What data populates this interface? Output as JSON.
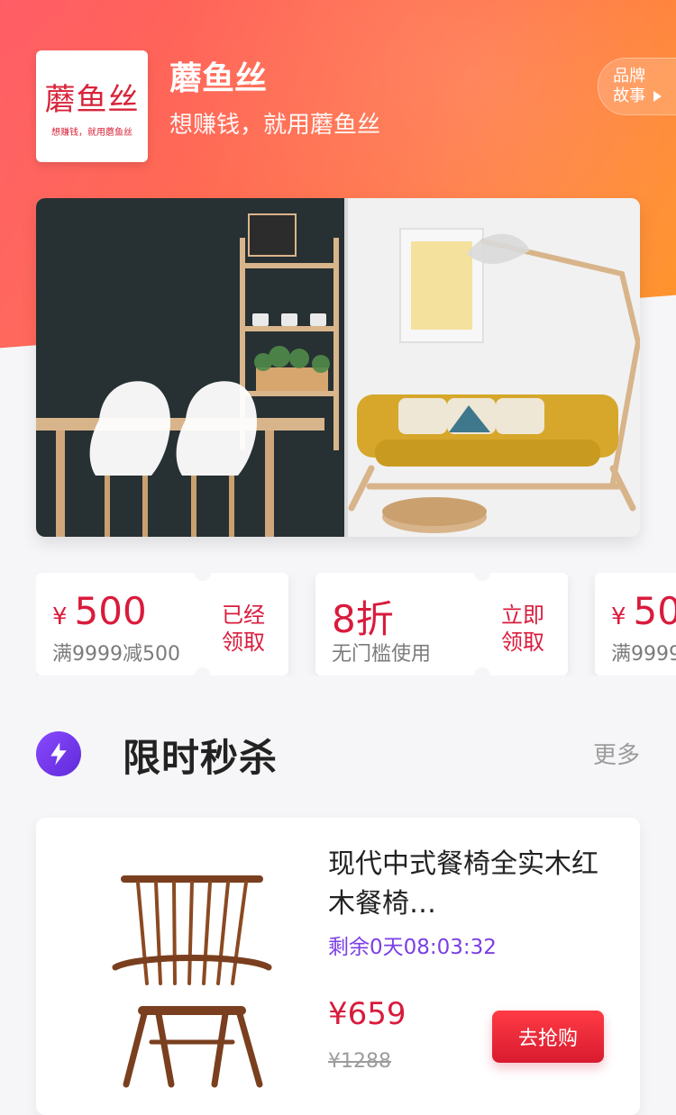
{
  "header": {
    "logo_text": "蘑鱼丝",
    "logo_subtext": "想赚钱，就用蘑鱼丝",
    "brand_name": "蘑鱼丝",
    "slogan": "想赚钱，就用蘑鱼丝",
    "brand_story_line1": "品牌",
    "brand_story_line2": "故事"
  },
  "coupons": [
    {
      "currency": "¥",
      "amount": "500",
      "condition": "满9999减500",
      "action_line1": "已经",
      "action_line2": "领取"
    },
    {
      "currency": "",
      "amount": "8折",
      "condition": "无门槛使用",
      "action_line1": "立即",
      "action_line2": "领取"
    },
    {
      "currency": "¥",
      "amount": "50",
      "condition": "满9999",
      "action_line1": "",
      "action_line2": ""
    }
  ],
  "flash_sale": {
    "title": "限时秒杀",
    "more": "更多",
    "product": {
      "title": "现代中式餐椅全实木红木餐椅…",
      "countdown": "剩余0天08:03:32",
      "price": "¥659",
      "original_price": "¥1288",
      "button": "去抢购"
    }
  },
  "colors": {
    "accent_red": "#d91b3c",
    "header_gradient_start": "#ff4b55",
    "header_gradient_end": "#ff9a2a",
    "purple": "#7b3fe4"
  }
}
